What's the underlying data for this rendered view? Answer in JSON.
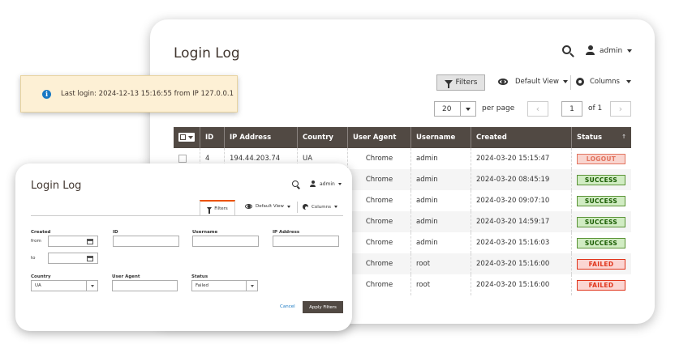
{
  "main": {
    "title": "Login Log",
    "user": "admin",
    "filters_button": "Filters",
    "default_view": "Default View",
    "columns": "Columns",
    "per_page_value": "20",
    "per_page_label": "per page",
    "page_current": "1",
    "page_of": "of 1",
    "table": {
      "headers": [
        "ID",
        "IP Address",
        "Country",
        "User Agent",
        "Username",
        "Created",
        "Status"
      ],
      "rows": [
        {
          "id": "4",
          "ip": "194.44.203.74",
          "country": "UA",
          "agent": "Chrome",
          "user": "admin",
          "created": "2024-03-20 15:15:47",
          "status": "LOGOUT"
        },
        {
          "id": "",
          "ip": "",
          "country": "",
          "agent": "Chrome",
          "user": "admin",
          "created": "2024-03-20 08:45:19",
          "status": "SUCCESS"
        },
        {
          "id": "",
          "ip": "",
          "country": "",
          "agent": "Chrome",
          "user": "admin",
          "created": "2024-03-20 09:07:10",
          "status": "SUCCESS"
        },
        {
          "id": "",
          "ip": "",
          "country": "",
          "agent": "Chrome",
          "user": "admin",
          "created": "2024-03-20 14:59:17",
          "status": "SUCCESS"
        },
        {
          "id": "",
          "ip": "",
          "country": "",
          "agent": "Chrome",
          "user": "admin",
          "created": "2024-03-20 15:16:03",
          "status": "SUCCESS"
        },
        {
          "id": "",
          "ip": "",
          "country": "",
          "agent": "Chrome",
          "user": "root",
          "created": "2024-03-20 15:16:00",
          "status": "FAILED"
        },
        {
          "id": "",
          "ip": "",
          "country": "",
          "agent": "Chrome",
          "user": "root",
          "created": "2024-03-20 15:16:00",
          "status": "FAILED"
        }
      ]
    }
  },
  "notice": {
    "text": "Last login: 2024-12-13 15:16:55 from IP 127.0.0.1",
    "icon": "info-icon",
    "color": "#1979c3"
  },
  "panel": {
    "title": "Login Log",
    "user": "admin",
    "filters_tab": "Filters",
    "default_view": "Default View",
    "columns": "Columns",
    "labels": {
      "created": "Created",
      "from": "from",
      "to": "to",
      "id": "ID",
      "username": "Username",
      "ip": "IP Address",
      "country": "Country",
      "agent": "User Agent",
      "status": "Status"
    },
    "country_value": "UA",
    "status_value": "Failed",
    "cancel": "Cancel",
    "apply": "Apply Filters"
  },
  "colors": {
    "header_bg": "#514943",
    "accent": "#eb5202",
    "link": "#1979c3"
  }
}
